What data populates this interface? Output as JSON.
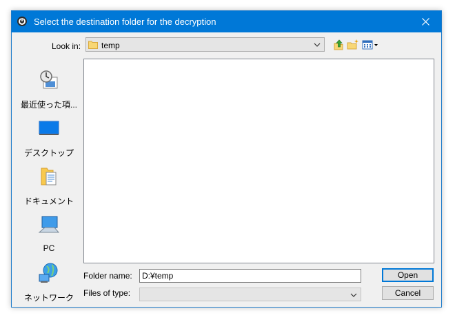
{
  "window": {
    "title": "Select the destination folder for the decryption",
    "accent": "#0078d7"
  },
  "lookin": {
    "label": "Look in:",
    "value": "temp",
    "folder_icon": "folder-icon"
  },
  "toolbar": {
    "icons": [
      "up-folder-icon",
      "new-folder-icon",
      "view-menu-icon"
    ]
  },
  "places": [
    {
      "label": "最近使った項...",
      "icon": "recent-places-icon"
    },
    {
      "label": "デスクトップ",
      "icon": "desktop-icon"
    },
    {
      "label": "ドキュメント",
      "icon": "documents-icon"
    },
    {
      "label": "PC",
      "icon": "computer-icon"
    },
    {
      "label": "ネットワーク",
      "icon": "network-icon"
    }
  ],
  "folder_name": {
    "label": "Folder name:",
    "value": "D:¥temp"
  },
  "files_of_type": {
    "label": "Files of type:",
    "value": ""
  },
  "buttons": {
    "open": "Open",
    "cancel": "Cancel"
  }
}
